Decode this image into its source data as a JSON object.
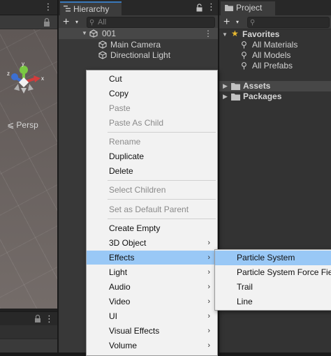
{
  "scene_panel": {
    "more_glyph": "⋮",
    "gizmo": {
      "x_label": "x",
      "y_label": "y",
      "z_label": "z"
    },
    "persp_label": "Persp",
    "game_more_glyph": "⋮"
  },
  "hierarchy": {
    "tab_label": "Hierarchy",
    "more_glyph": "⋮",
    "add_label": "+",
    "add_caret": "▾",
    "search_icon": "search-icon",
    "search_placeholder": "All",
    "scene_row": {
      "label": "001",
      "more_glyph": "⋮"
    },
    "children": [
      {
        "label": "Main Camera",
        "icon": "gameobject-icon"
      },
      {
        "label": "Directional Light",
        "icon": "gameobject-icon"
      }
    ],
    "accent_color": "#3a79bb"
  },
  "project": {
    "tab_label": "Project",
    "add_label": "+",
    "add_caret": "▾",
    "search_glyph": "⚲",
    "favorites": {
      "label": "Favorites",
      "items": [
        "All Materials",
        "All Models",
        "All Prefabs"
      ]
    },
    "folders": [
      {
        "label": "Assets"
      },
      {
        "label": "Packages"
      }
    ]
  },
  "context_menu": {
    "items": [
      {
        "label": "Cut",
        "disabled": false
      },
      {
        "label": "Copy",
        "disabled": false
      },
      {
        "label": "Paste",
        "disabled": true
      },
      {
        "label": "Paste As Child",
        "disabled": true
      },
      {
        "label": "Rename",
        "disabled": true
      },
      {
        "label": "Duplicate",
        "disabled": false
      },
      {
        "label": "Delete",
        "disabled": false
      },
      {
        "label": "Select Children",
        "disabled": true
      },
      {
        "label": "Set as Default Parent",
        "disabled": true
      },
      {
        "label": "Create Empty",
        "disabled": false
      },
      {
        "label": "3D Object",
        "has_submenu": true
      },
      {
        "label": "Effects",
        "has_submenu": true,
        "highlighted": true
      },
      {
        "label": "Light",
        "has_submenu": true
      },
      {
        "label": "Audio",
        "has_submenu": true
      },
      {
        "label": "Video",
        "has_submenu": true
      },
      {
        "label": "UI",
        "has_submenu": true
      },
      {
        "label": "Visual Effects",
        "has_submenu": true
      },
      {
        "label": "Volume",
        "has_submenu": true
      }
    ],
    "submenu_arrow": "›",
    "highlight_color": "#99c8f6"
  },
  "effects_submenu": {
    "items": [
      {
        "label": "Particle System",
        "highlighted": true
      },
      {
        "label": "Particle System Force Field"
      },
      {
        "label": "Trail"
      },
      {
        "label": "Line"
      }
    ]
  }
}
